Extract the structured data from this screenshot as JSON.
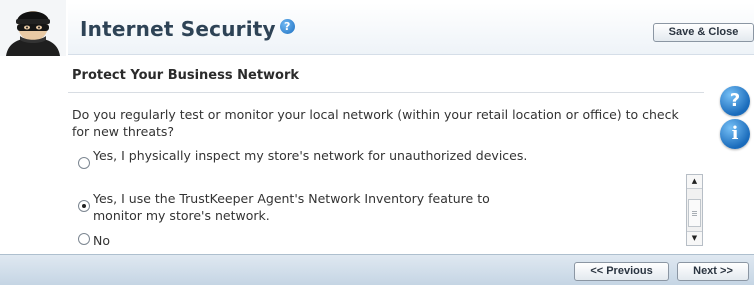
{
  "header": {
    "title": "Internet Security",
    "help_glyph": "?",
    "save_close_label": "Save & Close"
  },
  "section": {
    "title": "Protect Your Business Network",
    "question": "Do you regularly test or monitor your local network (within your retail location or office) to check for new threats?"
  },
  "options": [
    {
      "label": "Yes, I physically inspect my store's network for unauthorized devices.",
      "selected": false
    },
    {
      "label": "Yes, I use the TrustKeeper Agent's Network Inventory feature to monitor my store's network.",
      "selected": true
    },
    {
      "label": "No",
      "selected": false
    }
  ],
  "side_buttons": {
    "help_glyph": "?",
    "info_glyph": "i"
  },
  "footer": {
    "previous_label": "<< Previous",
    "next_label": "Next >>"
  },
  "icons": [
    "burglar-avatar-icon",
    "help-icon",
    "info-icon",
    "scroll-up-icon",
    "scroll-down-icon"
  ],
  "colors": {
    "title": "#2e4356",
    "accent_blue": "#1e6fc0",
    "footer_bg": "#c5d5e4"
  }
}
